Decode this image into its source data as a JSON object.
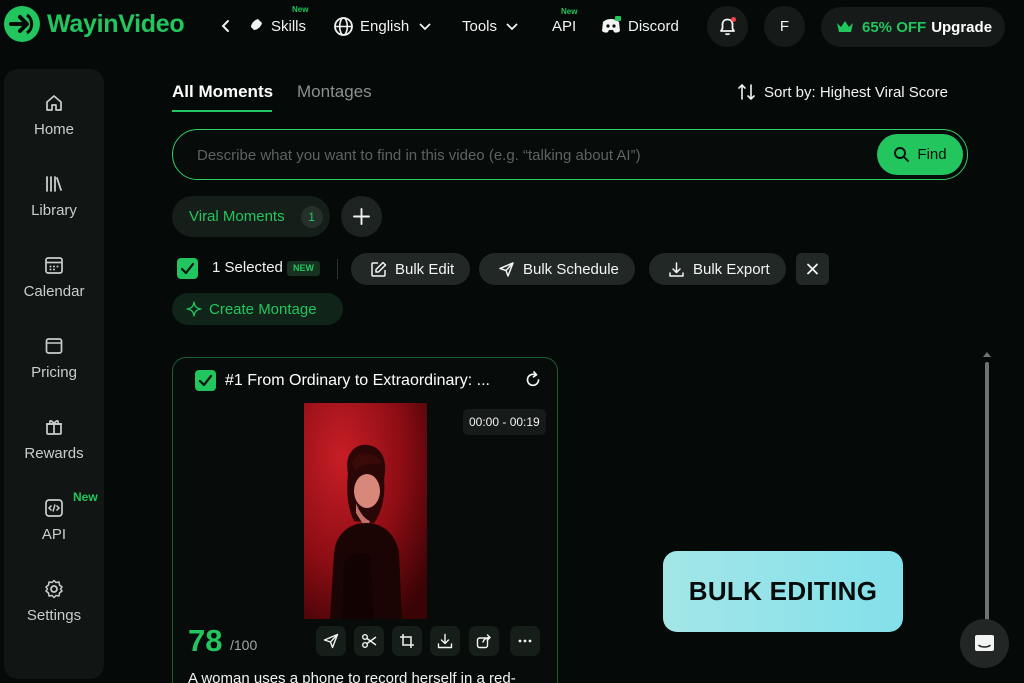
{
  "app": {
    "name": "WayinVideo"
  },
  "topnav": {
    "skills_label": "Skills",
    "skills_badge": "New",
    "language_label": "English",
    "tools_label": "Tools",
    "api_label": "API",
    "api_badge": "New",
    "discord_label": "Discord",
    "avatar_initial": "F",
    "upgrade_discount": "65% OFF",
    "upgrade_label": "Upgrade"
  },
  "sidebar": {
    "items": [
      {
        "label": "Home",
        "icon": "home-icon"
      },
      {
        "label": "Library",
        "icon": "library-icon"
      },
      {
        "label": "Calendar",
        "icon": "calendar-icon"
      },
      {
        "label": "Pricing",
        "icon": "wallet-icon"
      },
      {
        "label": "Rewards",
        "icon": "gift-icon"
      },
      {
        "label": "API",
        "icon": "code-icon"
      },
      {
        "label": "Settings",
        "icon": "gear-icon"
      }
    ],
    "api_badge": "New"
  },
  "tabs": {
    "active": "All Moments",
    "inactive": "Montages"
  },
  "sort": {
    "label": "Sort by: Highest Viral Score"
  },
  "search": {
    "placeholder": "Describe what you want to find in this video (e.g. “talking about AI”)",
    "button_label": "Find"
  },
  "filter": {
    "label": "Viral Moments",
    "count": "1"
  },
  "selection": {
    "selected_label": "1 Selected",
    "badge": "NEW",
    "bulk_edit": "Bulk Edit",
    "bulk_schedule": "Bulk Schedule",
    "bulk_export": "Bulk Export",
    "create_montage": "Create Montage"
  },
  "card": {
    "title": "#1 From Ordinary to Extraordinary: ...",
    "time_range": "00:00 - 00:19",
    "score": "78",
    "score_max": "/100",
    "description": "A woman uses a phone to record herself in a red-"
  },
  "banner": {
    "text": "BULK EDITING"
  },
  "colors": {
    "accent": "#22c55e",
    "background": "#050908",
    "banner": "#9ee6e9"
  }
}
